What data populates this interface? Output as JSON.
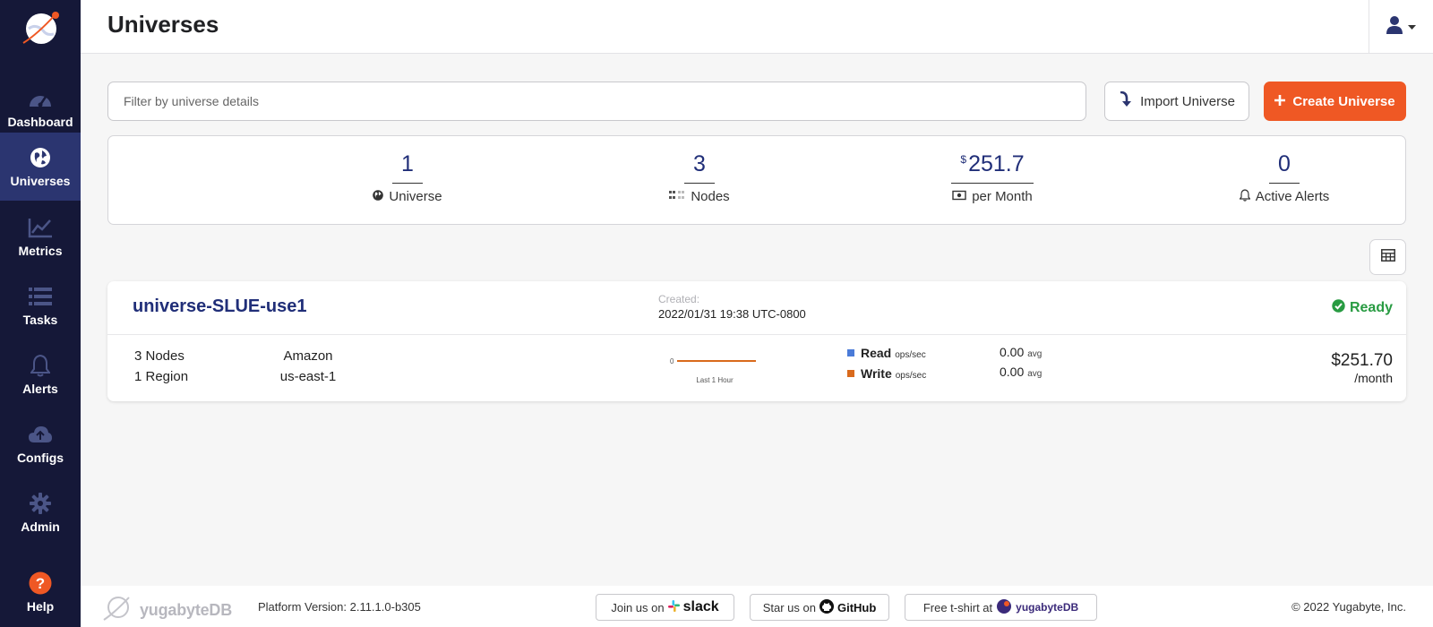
{
  "app": {
    "page_title": "Universes"
  },
  "sidebar": {
    "items": [
      {
        "label": "Dashboard",
        "icon": "dashboard-gauge-icon",
        "active": false
      },
      {
        "label": "Universes",
        "icon": "globe-icon",
        "active": true
      },
      {
        "label": "Metrics",
        "icon": "line-chart-icon",
        "active": false
      },
      {
        "label": "Tasks",
        "icon": "list-icon",
        "active": false
      },
      {
        "label": "Alerts",
        "icon": "bell-icon",
        "active": false
      },
      {
        "label": "Configs",
        "icon": "cloud-upload-icon",
        "active": false
      },
      {
        "label": "Admin",
        "icon": "gear-icon",
        "active": false
      },
      {
        "label": "Help",
        "icon": "help-question-icon",
        "active": false
      }
    ]
  },
  "toolbar": {
    "filter_placeholder": "Filter by universe details",
    "filter_value": "",
    "import_label": "Import Universe",
    "create_label": "Create Universe"
  },
  "summary": {
    "universes": {
      "value": "1",
      "label": "Universe"
    },
    "nodes": {
      "value": "3",
      "label": "Nodes"
    },
    "cost": {
      "currency": "$",
      "value": "251.7",
      "label": "per Month"
    },
    "alerts": {
      "value": "0",
      "label": "Active Alerts"
    }
  },
  "universe": {
    "name": "universe-SLUE-use1",
    "created_label": "Created:",
    "created_date": "2022/01/31 19:38 UTC-0800",
    "status": "Ready",
    "nodes": "3 Nodes",
    "regions": "1 Region",
    "provider": "Amazon",
    "provider_region": "us-east-1",
    "sparkline": {
      "y_label": "0",
      "x_label": "Last 1 Hour"
    },
    "metrics": [
      {
        "name": "Read",
        "unit": "ops/sec",
        "value": "0.00",
        "suffix": "avg",
        "color": "#4a7bd8"
      },
      {
        "name": "Write",
        "unit": "ops/sec",
        "value": "0.00",
        "suffix": "avg",
        "color": "#d96a1c"
      }
    ],
    "cost": "$251.70",
    "cost_period": "/month"
  },
  "footer": {
    "brand": "yugabyteDB",
    "version": "Platform Version: 2.11.1.0-b305",
    "slack_prefix": "Join us on",
    "slack_name": "slack",
    "github_prefix": "Star us on",
    "github_name": "GitHub",
    "tshirt_prefix": "Free t-shirt at",
    "tshirt_brand": "yugabyteDB",
    "copyright": "© 2022 Yugabyte, Inc."
  },
  "colors": {
    "sidebar_bg": "#151838",
    "sidebar_active": "#2b3570",
    "primary_orange": "#ef5824",
    "navy_text": "#202e78",
    "ready_green": "#289b42"
  }
}
